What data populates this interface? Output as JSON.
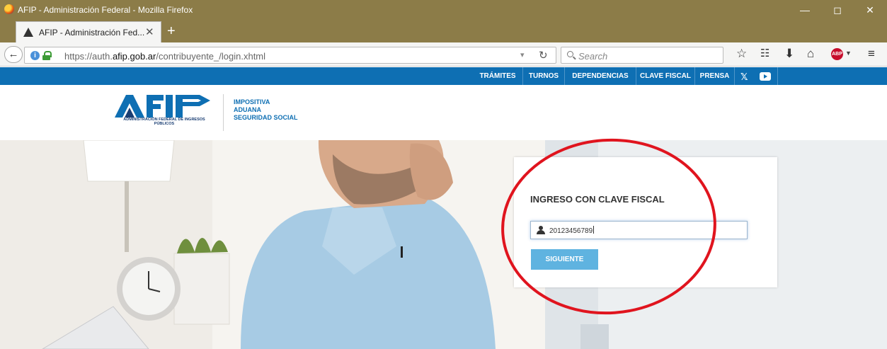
{
  "window": {
    "title": "AFIP - Administración Federal - Mozilla Firefox",
    "controls": {
      "minimize": "—",
      "maximize": "◻",
      "close": "✕"
    }
  },
  "tabs": [
    {
      "label": "AFIP - Administración Fed...",
      "close": "✕"
    }
  ],
  "new_tab": "+",
  "navbar": {
    "url_prefix": "https://auth.",
    "url_domain": "afip.gob.ar",
    "url_path": "/contribuyente_/login.xhtml",
    "search_placeholder": "Search",
    "icons": [
      "back-arrow-icon",
      "info-icon",
      "lock-icon",
      "reload-icon",
      "search-icon",
      "bookmark-star-icon",
      "reading-list-icon",
      "download-icon",
      "home-icon",
      "adblock-icon",
      "menu-icon"
    ],
    "abp_label": "ABP"
  },
  "site_nav": {
    "items": [
      "TRÁMITES",
      "TURNOS",
      "DEPENDENCIAS",
      "CLAVE FISCAL",
      "PRENSA"
    ],
    "accent": "#0e6fb3"
  },
  "logo": {
    "subtitle": "ADMINISTRACIÓN FEDERAL DE INGRESOS PÚBLICOS",
    "links": [
      "IMPOSITIVA",
      "ADUANA",
      "SEGURIDAD SOCIAL"
    ]
  },
  "login": {
    "title": "INGRESO CON CLAVE FISCAL",
    "cuit_value": "20123456789",
    "button_label": "SIGUIENTE",
    "button_color": "#5fb3e0"
  },
  "annotation": {
    "color": "#e0141e"
  }
}
